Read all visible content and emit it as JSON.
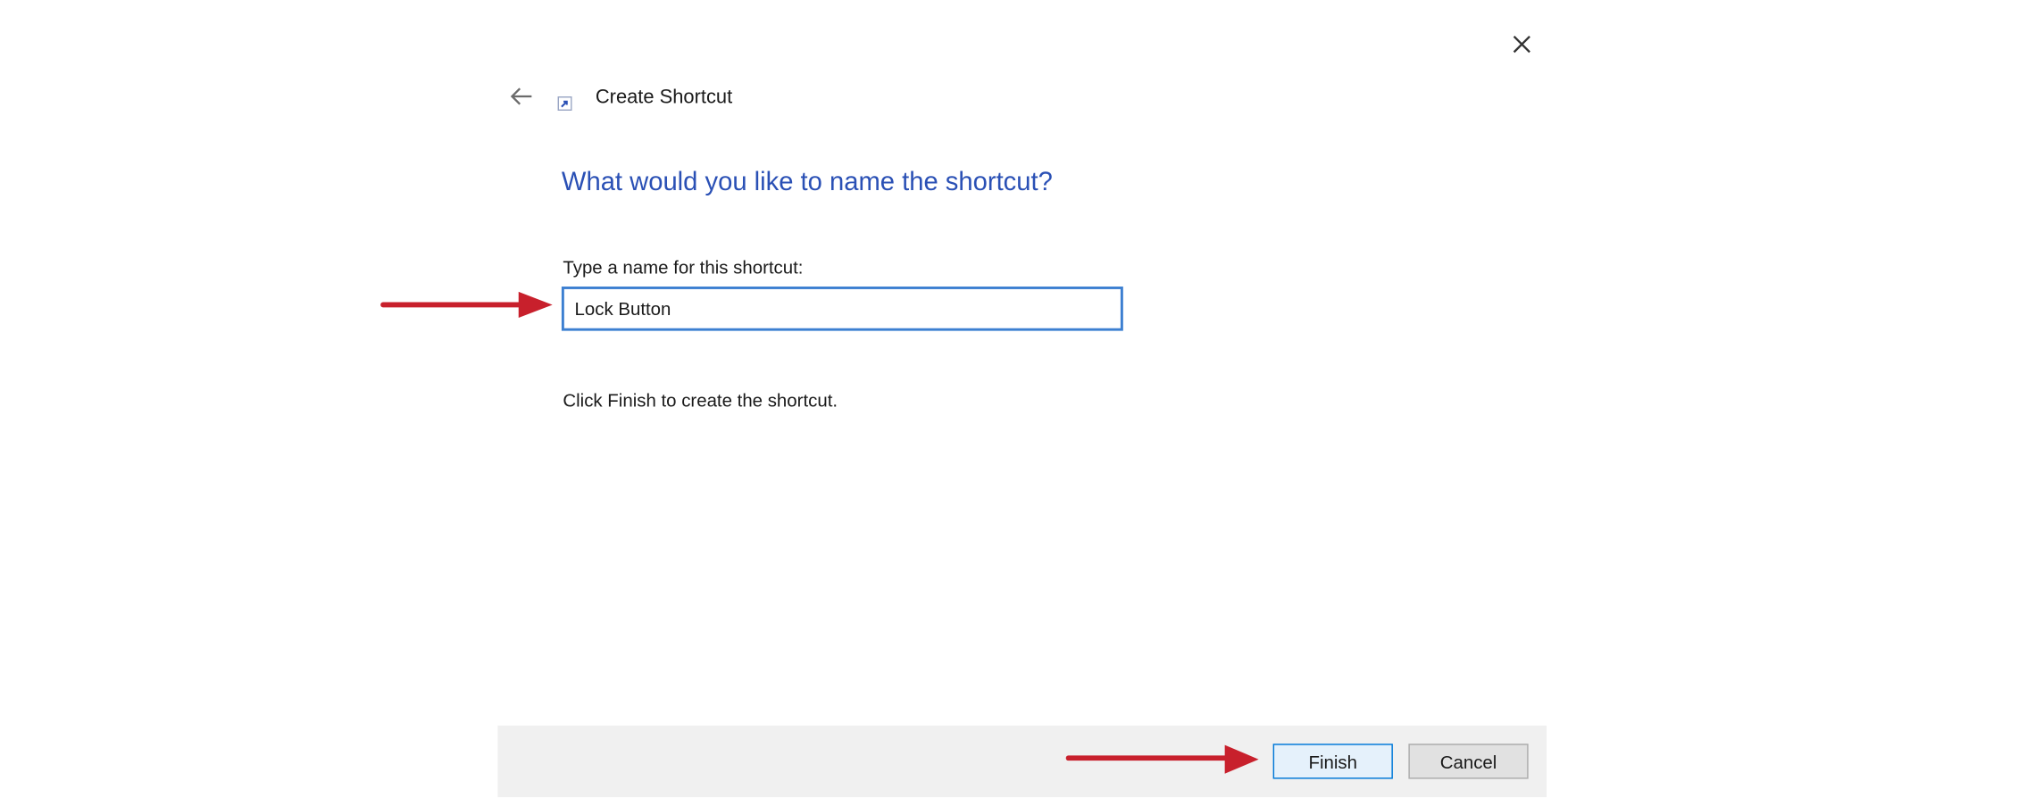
{
  "dialog": {
    "title": "Create Shortcut",
    "heading": "What would you like to name the shortcut?",
    "name_field": {
      "label": "Type a name for this shortcut:",
      "value": "Lock Button"
    },
    "instruction": "Click Finish to create the shortcut."
  },
  "footer": {
    "finish_label": "Finish",
    "cancel_label": "Cancel"
  },
  "icons": {
    "close": "close-icon",
    "back": "back-arrow-icon",
    "shortcut": "shortcut-icon",
    "annotation": "annotation-arrow-icon"
  },
  "colors": {
    "heading": "#2a50b5",
    "input_border": "#3c7fd1",
    "footer_bg": "#f0f0f0",
    "finish_border": "#0078d7",
    "annotation_arrow": "#c8202c"
  }
}
